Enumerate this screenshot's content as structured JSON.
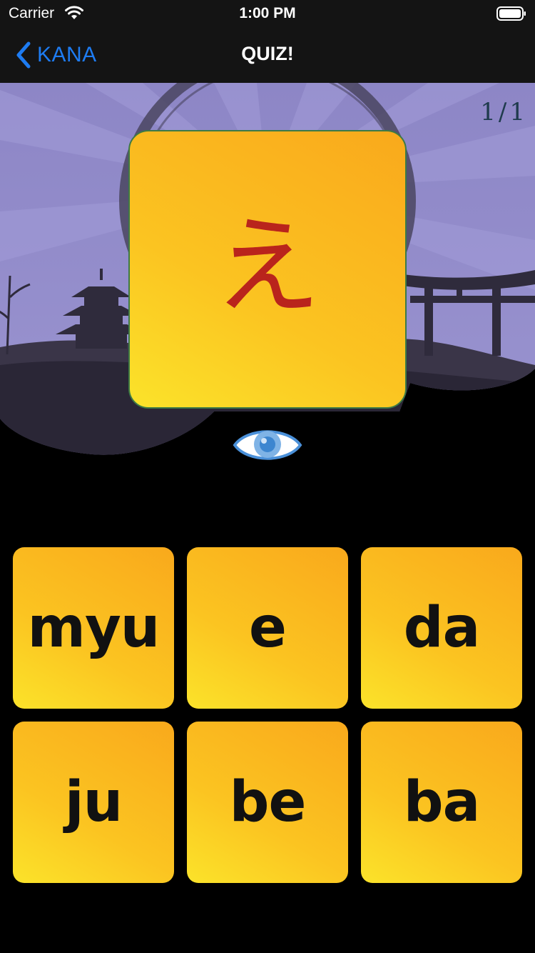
{
  "status_bar": {
    "carrier": "Carrier",
    "time": "1:00 PM",
    "wifi_icon": "wifi-icon",
    "battery_icon": "battery-full-icon"
  },
  "nav": {
    "back_label": "KANA",
    "back_icon": "chevron-left-icon",
    "title": "QUIZ!",
    "accent_color": "#1e7cf2"
  },
  "quiz": {
    "progress": "1/1",
    "kana": "え",
    "kana_color": "#b9241c",
    "card_colors": [
      "#fbe32a",
      "#f9a91c"
    ],
    "reveal_icon": "eye-icon"
  },
  "answers": [
    {
      "label": "myu"
    },
    {
      "label": "e"
    },
    {
      "label": "da"
    },
    {
      "label": "ju"
    },
    {
      "label": "be"
    },
    {
      "label": "ba"
    }
  ]
}
